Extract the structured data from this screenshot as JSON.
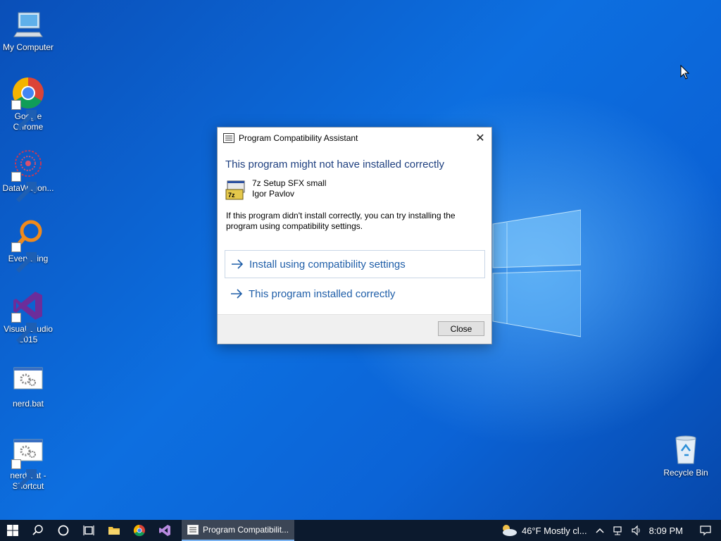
{
  "desktop": {
    "icons": [
      {
        "label": "My Computer",
        "icon": "computer-icon"
      },
      {
        "label": "Google Chrome",
        "icon": "chrome-icon"
      },
      {
        "label": "DataWagon...",
        "icon": "datawagon-icon"
      },
      {
        "label": "Everything",
        "icon": "search-magnifier-icon"
      },
      {
        "label": "Visual Studio 2015",
        "icon": "visual-studio-icon"
      },
      {
        "label": "nerd.bat",
        "icon": "bat-file-icon"
      },
      {
        "label": "nerd.bat - Shortcut",
        "icon": "bat-file-icon"
      },
      {
        "label": "Recycle Bin",
        "icon": "recycle-bin-icon"
      }
    ]
  },
  "dialog": {
    "title": "Program Compatibility Assistant",
    "heading": "This program might not have installed correctly",
    "program_name": "7z Setup SFX small",
    "publisher": "Igor Pavlov",
    "description": "If this program didn't install correctly, you can try installing the program using compatibility settings.",
    "option_install": "Install using compatibility settings",
    "option_ok": "This program installed correctly",
    "close_button": "Close"
  },
  "taskbar": {
    "active_task": "Program Compatibilit...",
    "weather": "46°F Mostly cl...",
    "time": "8:09 PM"
  },
  "colors": {
    "accent": "#1f5ea8",
    "heading": "#1e3f7f",
    "taskbar_bg": "#0c1a2e"
  }
}
